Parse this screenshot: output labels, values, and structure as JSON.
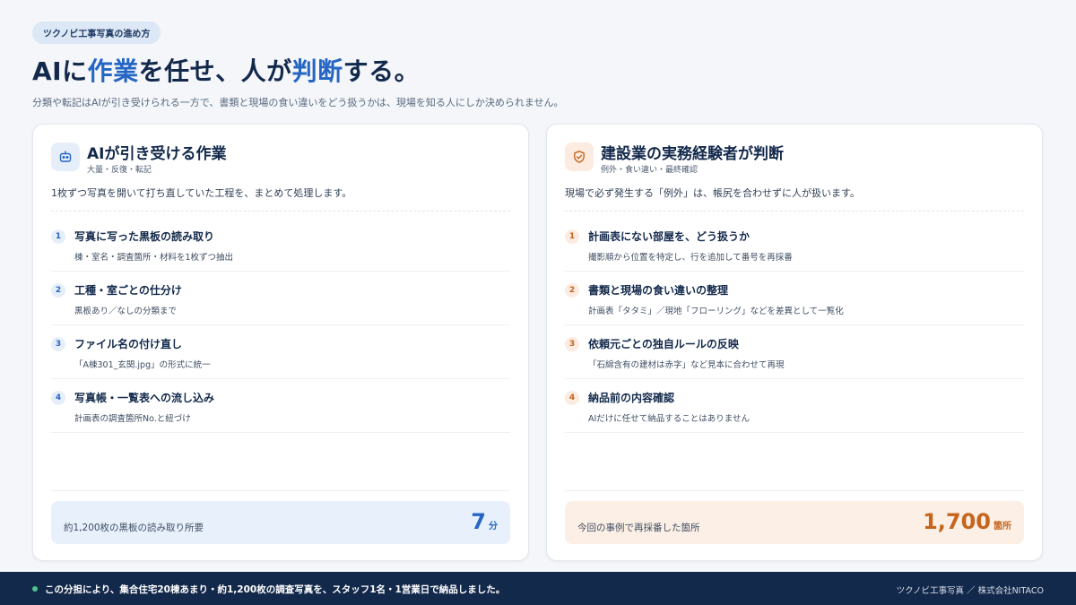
{
  "tag": "ツクノビ工事写真の進め方",
  "headline": {
    "part1": "AIに",
    "hl1": "作業",
    "part2": "を任せ、人が",
    "hl2": "判断",
    "part3": "する。"
  },
  "subtitle": "分類や転記はAIが引き受けられる一方で、書類と現場の食い違いをどう扱うかは、現場を知る人にしか決められません。",
  "colors": {
    "ai_accent": "#2566c4",
    "human_accent": "#c5651e",
    "footer_bg": "#13294b"
  },
  "ai_card": {
    "icon": "robot-icon",
    "title": "AIが引き受ける作業",
    "subtitle": "大量・反復・転記",
    "description": "1枚ずつ写真を開いて打ち直していた工程を、まとめて処理します。",
    "items": [
      {
        "num": "1",
        "title": "写真に写った黒板の読み取り",
        "desc": "棟・室名・調査箇所・材料を1枚ずつ抽出"
      },
      {
        "num": "2",
        "title": "工種・室ごとの仕分け",
        "desc": "黒板あり／なしの分類まで"
      },
      {
        "num": "3",
        "title": "ファイル名の付け直し",
        "desc": "「A棟301_玄関.jpg」の形式に統一"
      },
      {
        "num": "4",
        "title": "写真帳・一覧表への流し込み",
        "desc": "計画表の調査箇所No.と紐づけ"
      }
    ],
    "stat": {
      "label": "約1,200枚の黒板の読み取り所要",
      "value": "7",
      "unit": "分"
    }
  },
  "human_card": {
    "icon": "shield-check-icon",
    "title": "建設業の実務経験者が判断",
    "subtitle": "例外・食い違い・最終確認",
    "description": "現場で必ず発生する「例外」は、帳尻を合わせずに人が扱います。",
    "items": [
      {
        "num": "1",
        "title": "計画表にない部屋を、どう扱うか",
        "desc": "撮影順から位置を特定し、行を追加して番号を再採番"
      },
      {
        "num": "2",
        "title": "書類と現場の食い違いの整理",
        "desc": "計画表「タタミ」／現地「フローリング」などを差異として一覧化"
      },
      {
        "num": "3",
        "title": "依頼元ごとの独自ルールの反映",
        "desc": "「石綿含有の建材は赤字」など見本に合わせて再現"
      },
      {
        "num": "4",
        "title": "納品前の内容確認",
        "desc": "AIだけに任せて納品することはありません"
      }
    ],
    "stat": {
      "label": "今回の事例で再採番した箇所",
      "value": "1,700",
      "unit": "箇所"
    }
  },
  "footer": {
    "text": "この分担により、集合住宅20棟あまり・約1,200枚の調査写真を、スタッフ1名・1営業日で納品しました。",
    "brand": "ツクノビ工事写真 ／ 株式会社NITACO"
  }
}
